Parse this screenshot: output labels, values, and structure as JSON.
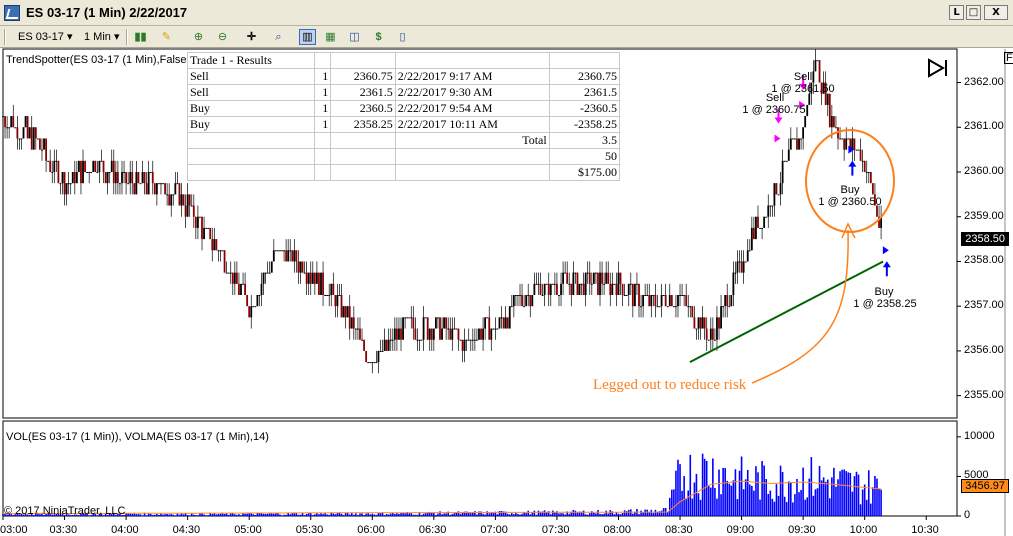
{
  "window": {
    "title": "ES 03-17 (1 Min)  2/22/2017",
    "buttons": {
      "minimize": "L",
      "maximize": "□",
      "close": "X"
    }
  },
  "toolbar": {
    "instrument": "ES 03-17",
    "interval": "1 Min",
    "icons": [
      "bar-type-icon",
      "drawing-pen-icon",
      "zoom-in-icon",
      "zoom-out-icon",
      "crosshair-icon",
      "search-icon",
      "chart-trader-icon",
      "chart-style-icon",
      "indicators-icon",
      "strategies-icon",
      "properties-icon"
    ]
  },
  "chart": {
    "indicator_label": "TrendSpotter(ES 03-17 (1 Min),False",
    "volume_label": "VOL(ES 03-17 (1 Min)), VOLMA(ES 03-17 (1 Min),14)",
    "copyright": "© 2017 NinjaTrader, LLC",
    "current_price": "2358.50",
    "current_volume": "3456.97",
    "f_marker": "F",
    "colors": {
      "up_bar": "#000000",
      "down_bar": "#8b0000",
      "volume": "#0000ff",
      "volma": "#ff8c1a",
      "trend_line": "#006400",
      "annotation": "#ff7f1a",
      "sell_arrow": "#ff00ff",
      "buy_arrow": "#0000ff"
    }
  },
  "trade_table": {
    "title": "Trade 1 - Results",
    "rows": [
      [
        "Sell",
        "1",
        "2360.75",
        "2/22/2017 9:17 AM",
        "2360.75"
      ],
      [
        "Sell",
        "1",
        "2361.5",
        "2/22/2017 9:30 AM",
        "2361.5"
      ],
      [
        "Buy",
        "1",
        "2360.5",
        "2/22/2017 9:54 AM",
        "-2360.5"
      ],
      [
        "Buy",
        "1",
        "2358.25",
        "2/22/2017 10:11  AM",
        "-2358.25"
      ]
    ],
    "total_label": "Total",
    "total": "3.5",
    "multiplier": "50",
    "profit": "$175.00"
  },
  "annotations": {
    "sell1_a": "Sell",
    "sell1_b": "1 @ 2360.75",
    "sell2_a": "Sell",
    "sell2_b": "1 @ 2361.50",
    "buy1_a": "Buy",
    "buy1_b": "1 @ 2360.50",
    "buy2_a": "Buy",
    "buy2_b": "1 @ 2358.25",
    "legged_out": "Legged out to reduce risk"
  },
  "chart_data": {
    "type": "candlestick",
    "price_axis": {
      "ticks": [
        "2362.00",
        "2361.00",
        "2360.00",
        "2359.00",
        "2358.00",
        "2357.00",
        "2356.00",
        "2355.00"
      ],
      "range": [
        2354.5,
        2362.75
      ]
    },
    "volume_axis": {
      "ticks": [
        "10000",
        "5000",
        "0"
      ],
      "range": [
        0,
        12000
      ]
    },
    "time_axis": [
      "03:00",
      "03:30",
      "04:00",
      "04:30",
      "05:00",
      "05:30",
      "06:00",
      "06:30",
      "07:00",
      "07:30",
      "08:00",
      "08:30",
      "09:00",
      "09:30",
      "10:00",
      "10:30"
    ],
    "price_path": [
      [
        3.0,
        2361.25
      ],
      [
        3.25,
        2360.75
      ],
      [
        3.5,
        2359.75
      ],
      [
        3.75,
        2360.25
      ],
      [
        4.0,
        2359.75
      ],
      [
        4.25,
        2359.75
      ],
      [
        4.5,
        2359.25
      ],
      [
        4.75,
        2358.25
      ],
      [
        5.0,
        2357.0
      ],
      [
        5.25,
        2358.25
      ],
      [
        5.5,
        2357.75
      ],
      [
        5.75,
        2357.0
      ],
      [
        6.0,
        2355.75
      ],
      [
        6.25,
        2356.5
      ],
      [
        6.5,
        2356.5
      ],
      [
        6.75,
        2356.25
      ],
      [
        7.0,
        2356.5
      ],
      [
        7.25,
        2357.25
      ],
      [
        7.5,
        2357.5
      ],
      [
        7.75,
        2357.5
      ],
      [
        8.0,
        2357.5
      ],
      [
        8.25,
        2357.0
      ],
      [
        8.5,
        2357.25
      ],
      [
        8.75,
        2356.25
      ],
      [
        9.0,
        2358.0
      ],
      [
        9.25,
        2359.5
      ],
      [
        9.5,
        2361.0
      ],
      [
        9.6,
        2362.5
      ],
      [
        9.75,
        2361.0
      ],
      [
        10.0,
        2360.25
      ],
      [
        10.15,
        2358.5
      ]
    ],
    "volume_profile": [
      [
        3.0,
        250
      ],
      [
        4.0,
        250
      ],
      [
        5.0,
        250
      ],
      [
        6.0,
        300
      ],
      [
        7.0,
        400
      ],
      [
        8.0,
        500
      ],
      [
        8.4,
        700
      ],
      [
        8.5,
        5200
      ],
      [
        8.75,
        5800
      ],
      [
        9.0,
        4600
      ],
      [
        9.25,
        4200
      ],
      [
        9.5,
        4800
      ],
      [
        9.75,
        4300
      ],
      [
        10.0,
        3800
      ],
      [
        10.15,
        3500
      ]
    ],
    "volma_path": [
      [
        3.0,
        300
      ],
      [
        8.4,
        500
      ],
      [
        8.5,
        1800
      ],
      [
        8.75,
        4000
      ],
      [
        9.0,
        4400
      ],
      [
        9.25,
        4100
      ],
      [
        9.5,
        4300
      ],
      [
        9.75,
        4000
      ],
      [
        10.0,
        3600
      ],
      [
        10.15,
        3400
      ]
    ],
    "trend_line": [
      [
        8.58,
        2355.75
      ],
      [
        10.15,
        2358.0
      ]
    ],
    "trades": [
      {
        "side": "Sell",
        "time": 9.3,
        "price": 2360.75
      },
      {
        "side": "Sell",
        "time": 9.5,
        "price": 2361.5
      },
      {
        "side": "Buy",
        "time": 9.9,
        "price": 2360.5
      },
      {
        "side": "Buy",
        "time": 10.18,
        "price": 2358.25
      }
    ]
  }
}
